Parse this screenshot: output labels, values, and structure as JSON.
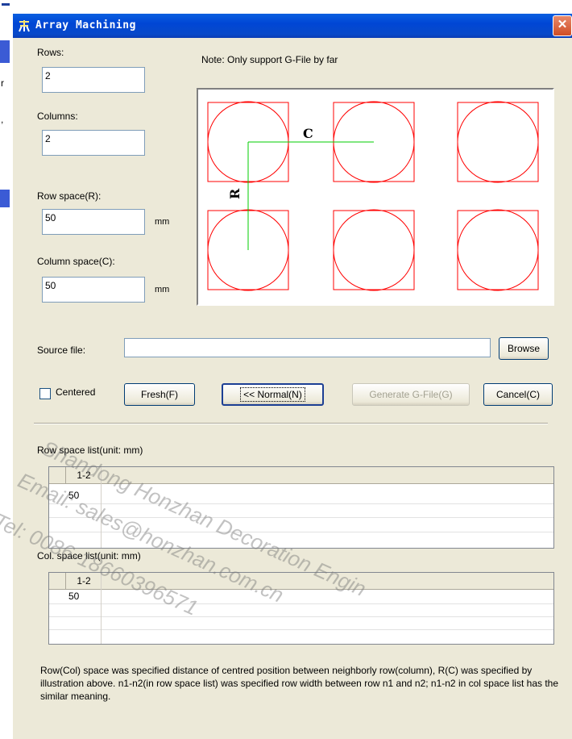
{
  "window": {
    "title": "Array Machining",
    "close_glyph": "✕"
  },
  "background_glyphs": [
    "r",
    ","
  ],
  "fields": {
    "rows": {
      "label": "Rows:",
      "value": "2"
    },
    "columns": {
      "label": "Columns:",
      "value": "2"
    },
    "row_space": {
      "label": "Row space(R):",
      "value": "50",
      "unit": "mm"
    },
    "col_space": {
      "label": "Column space(C):",
      "value": "50",
      "unit": "mm"
    }
  },
  "note_top": "Note: Only support G-File by far",
  "illustration": {
    "row_label": "R",
    "col_label": "C"
  },
  "source": {
    "label": "Source file:",
    "value": "",
    "browse": "Browse"
  },
  "actions": {
    "centered": "Centered",
    "fresh": "Fresh(F)",
    "normal": "<< Normal(N)",
    "generate": "Generate G-File(G)",
    "cancel": "Cancel(C)"
  },
  "row_list": {
    "title": "Row space list(unit: mm)",
    "header": "1-2",
    "value": "50"
  },
  "col_list": {
    "title": "Col. space list(unit: mm)",
    "header": "1-2",
    "value": "50"
  },
  "footer_note": "Row(Col) space was specified distance of centred position between neighborly row(column), R(C) was specified by illustration above. n1-n2(in row space list) was specified row width between row n1 and n2; n1-n2 in col space list has the similar meaning.",
  "watermark": {
    "line1": "Shandong Honzhan Decoration Engin",
    "line2": "Email: sales@honzhan.com.cn",
    "line3": "Tel: 0086-18660396571"
  },
  "colors": {
    "titlebar": "#0046d5",
    "dialog_bg": "#ece9d8",
    "shape_stroke": "#ff0000",
    "axis_line": "#00cc00"
  },
  "icons": {
    "app": "machining-app-icon",
    "close": "close-icon",
    "checkbox": "checkbox-unchecked"
  }
}
